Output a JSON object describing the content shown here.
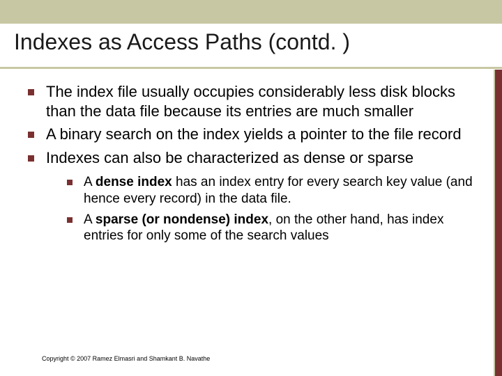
{
  "title": "Indexes as Access Paths (contd. )",
  "bullets": [
    {
      "text": "The index file usually occupies considerably less disk blocks than the data file because its entries are much smaller"
    },
    {
      "text": "A binary search on the index yields a pointer to the file record"
    },
    {
      "text": "Indexes can also be characterized as dense or sparse"
    }
  ],
  "sub_bullets": [
    {
      "prefix": "A ",
      "bold": "dense index",
      "suffix": " has an index entry for every search key value (and hence every record) in the data file."
    },
    {
      "prefix": "A ",
      "bold": "sparse (or nondense) index",
      "suffix": ", on the other hand, has index entries for only some of the search values"
    }
  ],
  "footer": "Copyright © 2007 Ramez Elmasri and Shamkant B. Navathe"
}
